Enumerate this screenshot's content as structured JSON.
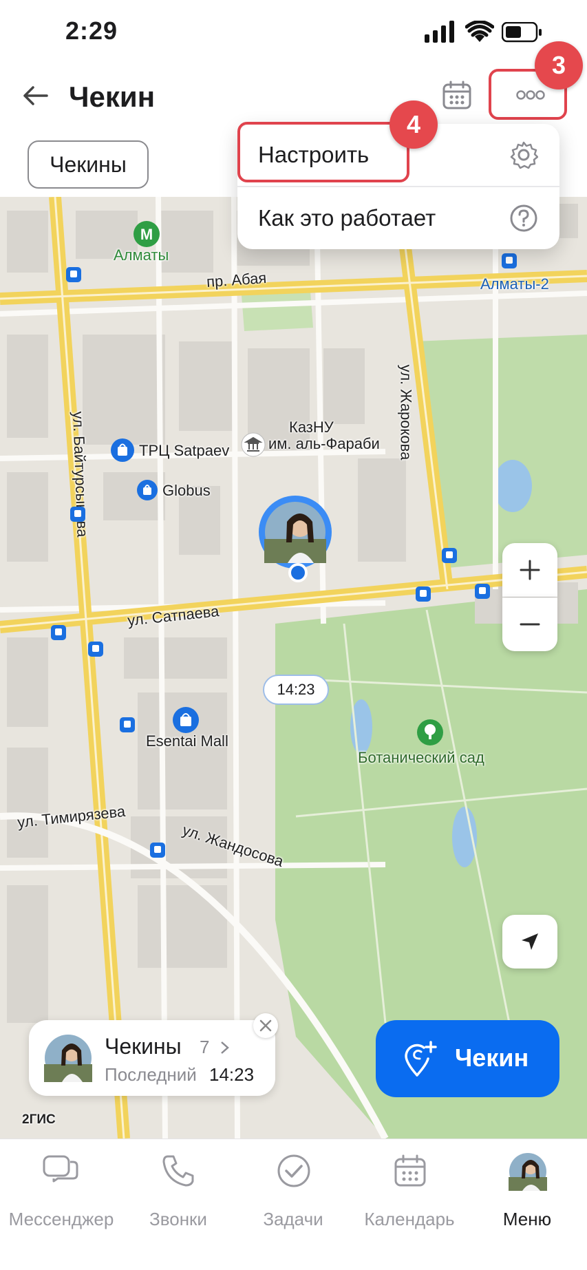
{
  "status_bar": {
    "time": "2:29"
  },
  "header": {
    "title": "Чекин",
    "chip_label": "Чекины"
  },
  "menu": {
    "items": [
      {
        "label": "Настроить",
        "icon": "gear-icon"
      },
      {
        "label": "Как это работает",
        "icon": "question-circle-icon"
      }
    ]
  },
  "badges": {
    "more": "3",
    "settings": "4"
  },
  "map": {
    "labels": {
      "metro": "Алматы",
      "station": "Алматы-2",
      "abaya": "пр. Абая",
      "zharokova": "ул. Жарокова",
      "baytursynova": "ул. Байтурсынова",
      "kaznu": "КазНУ",
      "kaznu2": "им. аль-Фараби",
      "satpaev_mall": "ТРЦ Satpaev",
      "globus": "Globus",
      "satpaeva": "ул. Сатпаева",
      "esentai": "Esentai Mall",
      "botanic": "Ботанический сад",
      "timiryazeva": "ул. Тимирязева",
      "zhandosova": "ул. Жандосова",
      "gis": "2ГИС"
    },
    "pin_time": "14:23"
  },
  "card": {
    "title": "Чекины",
    "count": "7",
    "last_label": "Последний",
    "last_time": "14:23"
  },
  "checkin_button": {
    "label": "Чекин"
  },
  "tabs": [
    {
      "label": "Мессенджер",
      "icon": "chat-icon",
      "active": false
    },
    {
      "label": "Звонки",
      "icon": "phone-icon",
      "active": false
    },
    {
      "label": "Задачи",
      "icon": "check-circle-icon",
      "active": false
    },
    {
      "label": "Календарь",
      "icon": "calendar-icon",
      "active": false
    },
    {
      "label": "Меню",
      "icon": "avatar",
      "active": true
    }
  ],
  "colors": {
    "accent": "#0a6cf0",
    "highlight": "#e0434d",
    "park": "#b9d9a3",
    "road_major": "#f2d35c"
  }
}
